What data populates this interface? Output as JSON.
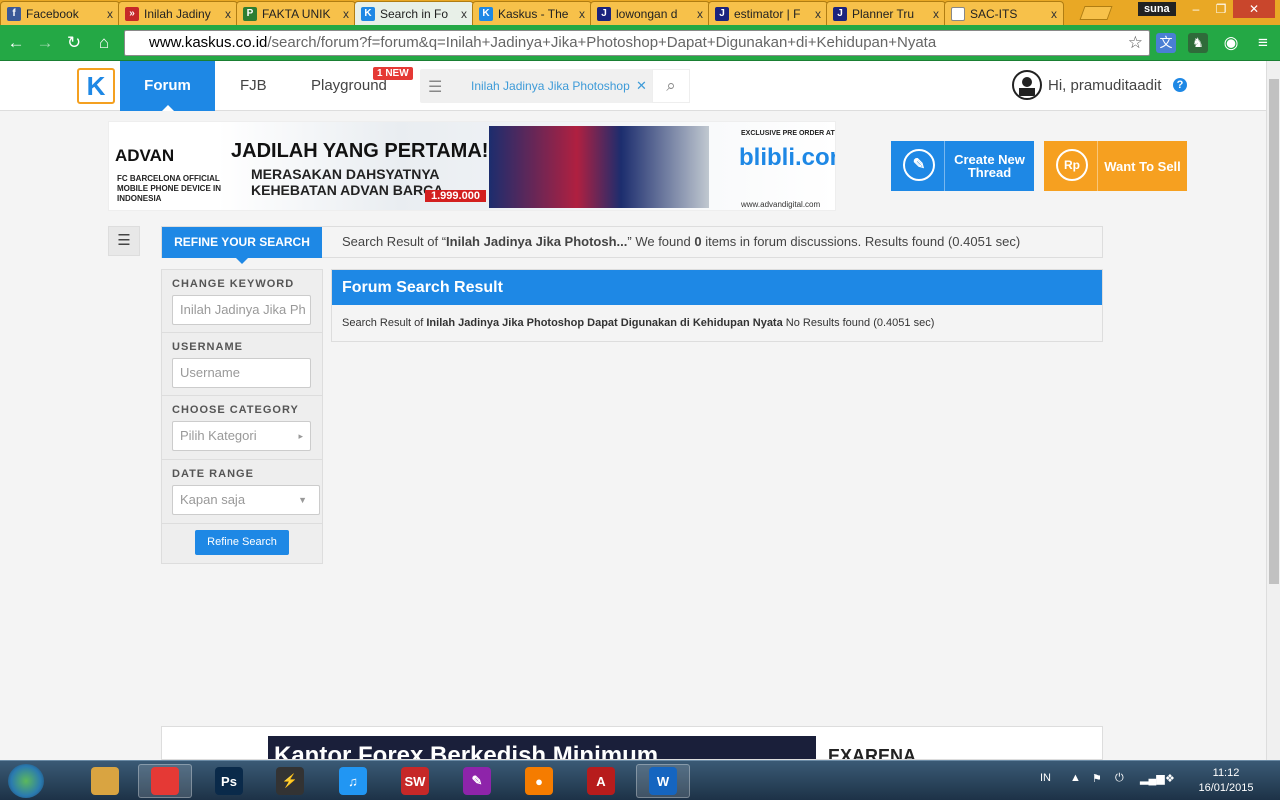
{
  "browser": {
    "tabs": [
      {
        "title": "Facebook",
        "color": "#3b5998",
        "glyph": "f"
      },
      {
        "title": "Inilah Jadiny",
        "color": "#c62828",
        "glyph": "»"
      },
      {
        "title": "FAKTA UNIK",
        "color": "#2e7d32",
        "glyph": "P"
      },
      {
        "title": "Search in Fo",
        "color": "#1e88e5",
        "glyph": "K",
        "active": true
      },
      {
        "title": "Kaskus - The",
        "color": "#1e88e5",
        "glyph": "K"
      },
      {
        "title": "lowongan d",
        "color": "#1a237e",
        "glyph": "J"
      },
      {
        "title": "estimator | F",
        "color": "#1a237e",
        "glyph": "J"
      },
      {
        "title": "Planner Tru",
        "color": "#1a237e",
        "glyph": "J"
      },
      {
        "title": "SAC-ITS",
        "color": "#ffffff",
        "glyph": ""
      }
    ],
    "tab_close": "x",
    "window_user": "suna",
    "url_host": "www.kaskus.co.id",
    "url_rest": "/search/forum?f=forum&q=Inilah+Jadinya+Jika+Photoshop+Dapat+Digunakan+di+Kehidupan+Nyata"
  },
  "nav": {
    "logo": "K",
    "forum": "Forum",
    "fjb": "FJB",
    "playground": "Playground",
    "new_badge": "1 NEW",
    "search_text": "Inilah Jadinya Jika Photoshop",
    "user_greeting": "Hi, pramuditaadit",
    "help": "?"
  },
  "banner": {
    "brand": "ADVAN",
    "sub": "FC BARCELONA OFFICIAL MOBILE PHONE DEVICE IN INDONESIA",
    "headline": "JADILAH YANG PERTAMA!",
    "tagline1": "MERASAKAN DAHSYATNYA",
    "tagline2": "KEHEBATAN ADVAN BARCA",
    "price": "1.999.000",
    "preorder": "EXCLUSIVE PRE ORDER AT",
    "store": "blibli.com",
    "url": "www.advandigital.com"
  },
  "actions": {
    "create_line1": "Create New",
    "create_line2": "Thread",
    "sell": "Want To Sell",
    "sell_icon": "Rp"
  },
  "refine": {
    "tab_label": "REFINE YOUR SEARCH",
    "summary_prefix": "Search Result of “",
    "summary_query": "Inilah Jadinya Jika Photosh...",
    "summary_mid": "” We found ",
    "summary_count": "0",
    "summary_suffix": " items in forum discussions. Results found (0.4051 sec)"
  },
  "sidebar": {
    "keyword_label": "CHANGE KEYWORD",
    "keyword_value": "Inilah Jadinya Jika Ph",
    "username_label": "USERNAME",
    "username_placeholder": "Username",
    "category_label": "CHOOSE CATEGORY",
    "category_value": "Pilih Kategori",
    "date_label": "DATE RANGE",
    "date_value": "Kapan saja",
    "button": "Refine Search"
  },
  "result": {
    "title": "Forum Search Result",
    "prefix": "Search Result of ",
    "query": "Inilah Jadinya Jika Photoshop Dapat Digunakan di Kehidupan Nyata",
    "suffix": " No Results found (0.4051 sec)"
  },
  "footer_ad": {
    "left": "Kantor Forex Berkedish Minimum",
    "right": "EXARENA"
  },
  "taskbar": {
    "lang": "IN",
    "time": "11:12",
    "date": "16/01/2015",
    "apps": [
      {
        "name": "explorer",
        "label": "",
        "color": "#d9a441"
      },
      {
        "name": "chrome",
        "label": "",
        "color": "#e53935"
      },
      {
        "name": "photoshop",
        "label": "Ps",
        "color": "#0a2a4a"
      },
      {
        "name": "lightning",
        "label": "⚡",
        "color": "#333"
      },
      {
        "name": "itunes",
        "label": "♫",
        "color": "#2196f3"
      },
      {
        "name": "solidworks",
        "label": "SW",
        "color": "#c62828"
      },
      {
        "name": "paint",
        "label": "✎",
        "color": "#8e24aa"
      },
      {
        "name": "media",
        "label": "●",
        "color": "#f57c00"
      },
      {
        "name": "autocad",
        "label": "A",
        "color": "#b71c1c"
      },
      {
        "name": "word",
        "label": "W",
        "color": "#1565c0"
      }
    ]
  }
}
